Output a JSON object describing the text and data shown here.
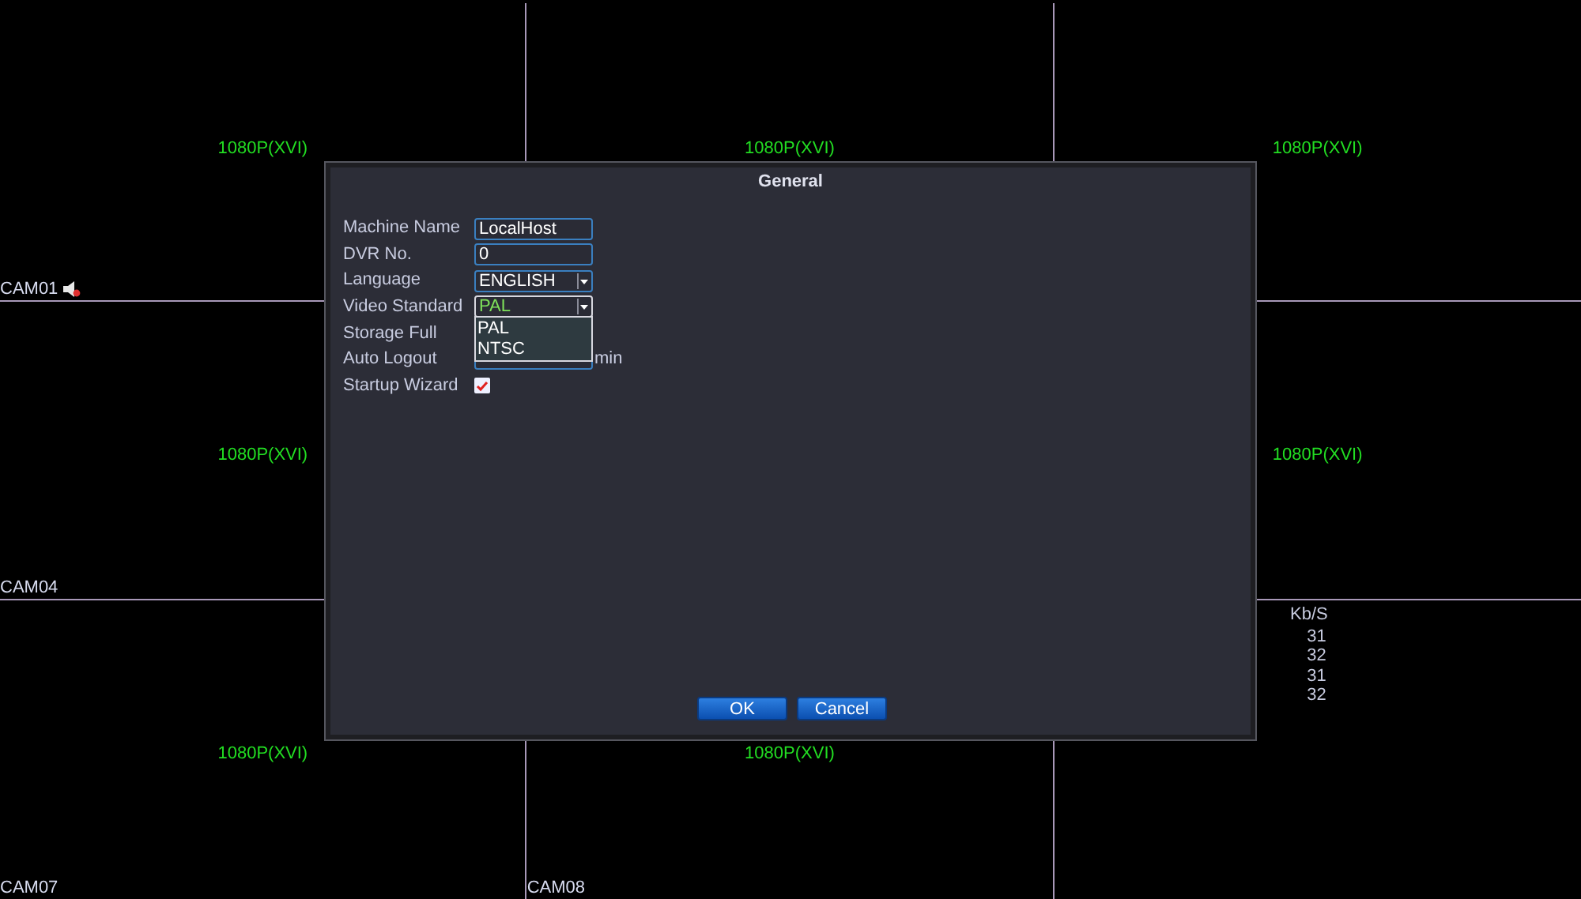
{
  "cells": [
    {
      "resolution": "1080P(XVI)",
      "camera": "CAM01",
      "audio": true
    },
    {
      "resolution": "1080P(XVI)"
    },
    {
      "resolution": "1080P(XVI)"
    },
    {
      "resolution": "1080P(XVI)",
      "camera": "CAM04"
    },
    {},
    {
      "resolution": "1080P(XVI)"
    },
    {
      "resolution": "1080P(XVI)",
      "camera": "CAM07"
    },
    {
      "resolution": "1080P(XVI)",
      "camera": "CAM08"
    },
    {}
  ],
  "bitrate": {
    "header": "Kb/S",
    "values": [
      "31",
      "32",
      "31",
      "32"
    ]
  },
  "dialog": {
    "title": "General",
    "fields": [
      {
        "label": "Machine Name",
        "kind": "text",
        "value": "LocalHost"
      },
      {
        "label": "DVR No.",
        "kind": "text",
        "value": "0"
      },
      {
        "label": "Language",
        "kind": "select",
        "value": "ENGLISH"
      },
      {
        "label": "Video Standard",
        "kind": "select",
        "value": "PAL",
        "expanded": true,
        "options": [
          "PAL",
          "NTSC"
        ]
      },
      {
        "label": "Storage Full",
        "kind": "hidden"
      },
      {
        "label": "Auto Logout",
        "kind": "text",
        "unit": "min"
      },
      {
        "label": "Startup Wizard",
        "kind": "checkbox",
        "checked": true
      }
    ],
    "buttons": [
      "OK",
      "Cancel"
    ]
  }
}
